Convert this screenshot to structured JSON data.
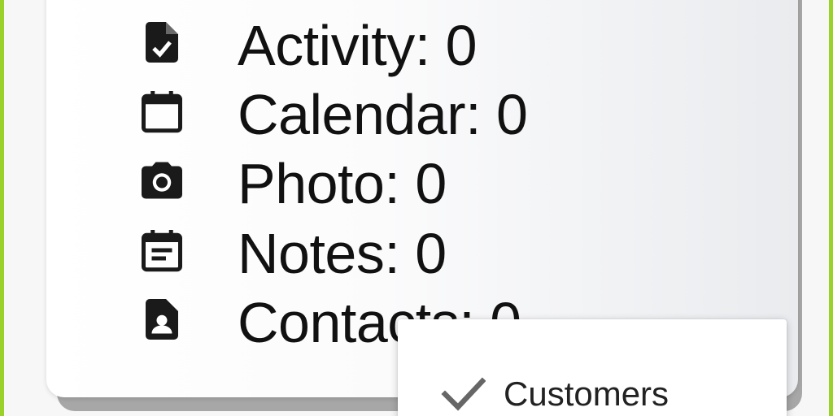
{
  "summary": {
    "items": [
      {
        "label": "Activity: 0",
        "icon": "file-check-icon"
      },
      {
        "label": "Calendar: 0",
        "icon": "calendar-icon"
      },
      {
        "label": "Photo: 0",
        "icon": "camera-icon"
      },
      {
        "label": "Notes: 0",
        "icon": "event-note-icon"
      },
      {
        "label": "Contacts: 0",
        "icon": "contact-file-icon"
      }
    ]
  },
  "dropdown_menu": {
    "items": [
      {
        "label": "Customers",
        "selected": true,
        "icon": "check-icon"
      }
    ]
  },
  "colors": {
    "accent_border": "#9ad12a",
    "text": "#111111",
    "icon": "#1a1a1a",
    "check": "#666666"
  }
}
